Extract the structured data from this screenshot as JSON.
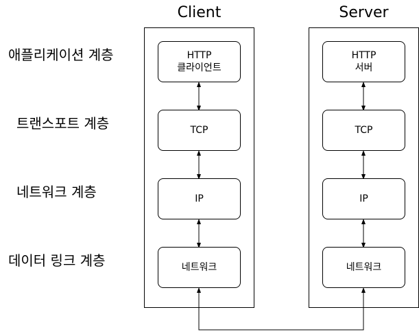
{
  "columns": {
    "client": {
      "title": "Client",
      "boxes": [
        {
          "line1": "HTTP",
          "line2": "클라이언트"
        },
        {
          "line1": "TCP",
          "line2": ""
        },
        {
          "line1": "IP",
          "line2": ""
        },
        {
          "line1": "네트워크",
          "line2": ""
        }
      ]
    },
    "server": {
      "title": "Server",
      "boxes": [
        {
          "line1": "HTTP",
          "line2": "서버"
        },
        {
          "line1": "TCP",
          "line2": ""
        },
        {
          "line1": "IP",
          "line2": ""
        },
        {
          "line1": "네트워크",
          "line2": ""
        }
      ]
    }
  },
  "layers": [
    "애플리케이션 계층",
    "트랜스포트 계층",
    "네트워크 계층",
    "데이터 링크 계층"
  ]
}
